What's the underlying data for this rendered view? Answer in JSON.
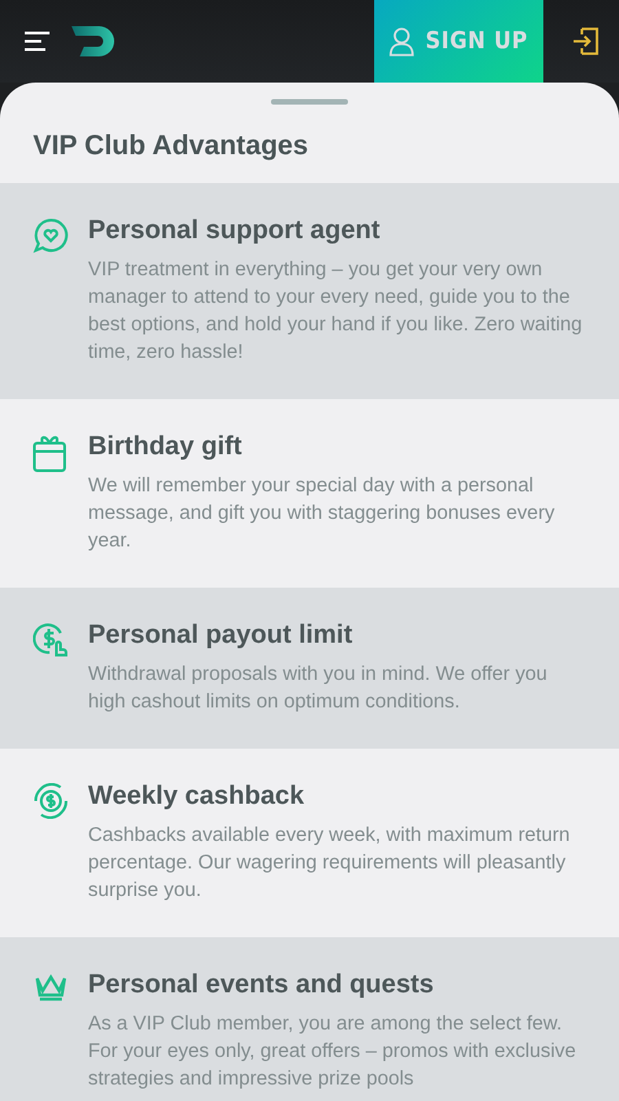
{
  "header": {
    "signup_button": "SIGN UP"
  },
  "sheet": {
    "title": "VIP Club Advantages",
    "advantages": [
      {
        "kind": "support",
        "title": "Personal support agent",
        "description": "VIP treatment in everything – you get your very own manager to attend to your every need, guide you to the best options, and hold your hand if you like. Zero waiting time, zero hassle!"
      },
      {
        "kind": "gift",
        "title": "Birthday gift",
        "description": "We will remember your special day with a personal message, and gift you with staggering bonuses every year."
      },
      {
        "kind": "payout",
        "title": "Personal payout limit",
        "description": "Withdrawal proposals with you in mind. We offer you high cashout limits on optimum conditions."
      },
      {
        "kind": "cashback",
        "title": "Weekly cashback",
        "description": "Cashbacks available every week, with maximum return percentage. Our wagering requirements will pleasantly surprise you."
      },
      {
        "kind": "crown",
        "title": "Personal events and quests",
        "description": "As a VIP Club member, you are among the select few. For your eyes only, great offers – promos with exclusive strategies and impressive prize pools"
      }
    ]
  }
}
